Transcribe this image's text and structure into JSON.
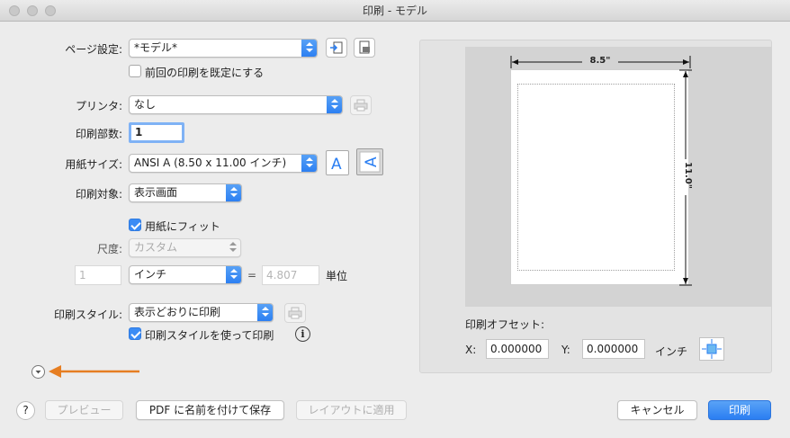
{
  "window": {
    "title": "印刷 - モデル"
  },
  "page_setup": {
    "label": "ページ設定:",
    "value": "*モデル*",
    "checkbox_label": "前回の印刷を既定にする",
    "checkbox_checked": false
  },
  "printer": {
    "label": "プリンタ:",
    "value": "なし"
  },
  "copies": {
    "label": "印刷部数:",
    "value": "1"
  },
  "paper_size": {
    "label": "用紙サイズ:",
    "value": "ANSI A (8.50 x 11.00 インチ)"
  },
  "print_area": {
    "label": "印刷対象:",
    "value": "表示画面"
  },
  "fit_to_paper": {
    "label": "用紙にフィット",
    "checked": true
  },
  "scale": {
    "label": "尺度:",
    "value": "カスタム",
    "left_value": "1",
    "unit_value": "インチ",
    "equals": "=",
    "right_value": "4.807",
    "unit_label": "単位"
  },
  "plot_style": {
    "label": "印刷スタイル:",
    "value": "表示どおりに印刷",
    "checkbox_label": "印刷スタイルを使って印刷",
    "checkbox_checked": true,
    "info_glyph": "i"
  },
  "preview": {
    "width_label": "8.5\"",
    "height_label": "11.0\""
  },
  "offset": {
    "title": "印刷オフセット:",
    "x_label": "X:",
    "x_value": "0.000000",
    "y_label": "Y:",
    "y_value": "0.000000",
    "unit": "インチ"
  },
  "buttons": {
    "help": "?",
    "preview": "プレビュー",
    "save_pdf": "PDF に名前を付けて保存",
    "apply_layout": "レイアウトに適用",
    "cancel": "キャンセル",
    "print": "印刷"
  },
  "colors": {
    "accent": "#2a7ef2",
    "arrow": "#e67e22"
  }
}
